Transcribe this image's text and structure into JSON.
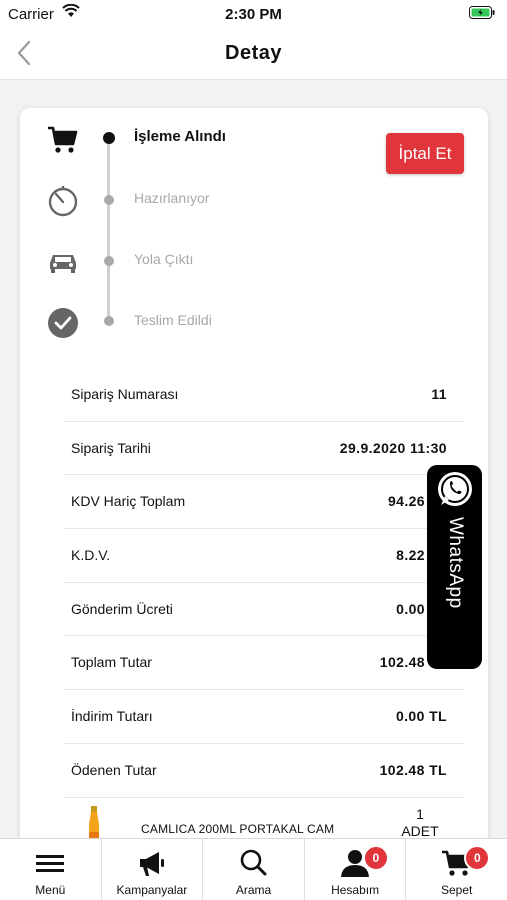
{
  "status_bar": {
    "carrier": "Carrier",
    "time": "2:30 PM"
  },
  "nav": {
    "title": "Detay"
  },
  "order_status": {
    "steps": [
      {
        "label": "İşleme Alındı",
        "icon": "cart-icon",
        "active": true
      },
      {
        "label": "Hazırlanıyor",
        "icon": "timer-icon",
        "active": false
      },
      {
        "label": "Yola Çıktı",
        "icon": "car-icon",
        "active": false
      },
      {
        "label": "Teslim Edildi",
        "icon": "check-circle-icon",
        "active": false
      }
    ],
    "cancel_label": "İptal Et"
  },
  "details": [
    {
      "label": "Sipariş Numarası",
      "value": "11"
    },
    {
      "label": "Sipariş Tarihi",
      "value": "29.9.2020 11:30"
    },
    {
      "label": "KDV Hariç Toplam",
      "value": "94.26"
    },
    {
      "label": "K.D.V.",
      "value": "8.22"
    },
    {
      "label": "Gönderim Ücreti",
      "value": "0.00"
    },
    {
      "label": "Toplam Tutar",
      "value": "102.48"
    },
    {
      "label": "İndirim Tutarı",
      "value": "0.00 TL"
    },
    {
      "label": "Ödenen Tutar",
      "value": "102.48 TL"
    }
  ],
  "product": {
    "name": "CAMLICA 200ML PORTAKAL CAM",
    "qty_number": "1",
    "qty_unit": "ADET"
  },
  "whatsapp": {
    "label": "WhatsApp"
  },
  "tabs": [
    {
      "label": "Menü",
      "icon": "hamburger-icon"
    },
    {
      "label": "Kampanyalar",
      "icon": "megaphone-icon"
    },
    {
      "label": "Arama",
      "icon": "search-icon"
    },
    {
      "label": "Hesabım",
      "icon": "user-icon",
      "badge": "0"
    },
    {
      "label": "Sepet",
      "icon": "cart-icon",
      "badge": "0"
    }
  ],
  "colors": {
    "accent_red": "#e0353a",
    "inactive_gray": "#a8a8a8"
  }
}
